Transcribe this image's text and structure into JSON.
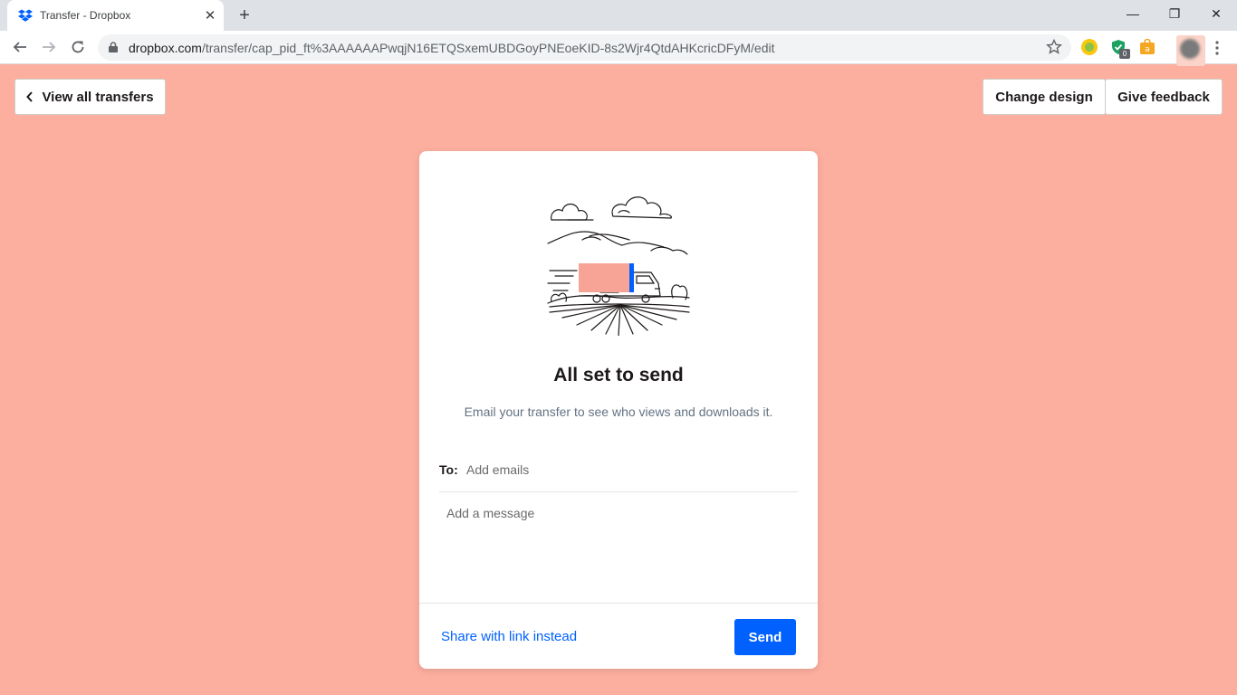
{
  "browser": {
    "tab_title": "Transfer - Dropbox",
    "tab_close": "✕",
    "new_tab": "+",
    "url_host": "dropbox.com",
    "url_path": "/transfer/cap_pid_ft%3AAAAAAPwqjN16ETQSxemUBDGoyPNEoeKID-8s2Wjr4QtdAHKcricDFyM/edit",
    "extension_badge": "0",
    "window_controls": {
      "minimize": "—",
      "maximize": "❐",
      "close": "✕"
    }
  },
  "header": {
    "back_label": "View all transfers",
    "change_design_label": "Change design",
    "give_feedback_label": "Give feedback"
  },
  "card": {
    "heading": "All set to send",
    "subtext": "Email your transfer to see who views and downloads it.",
    "to_label": "To:",
    "to_placeholder": "Add emails",
    "message_placeholder": "Add a message",
    "share_link_label": "Share with link instead",
    "send_label": "Send"
  },
  "colors": {
    "page_background": "#fdaf9f",
    "primary_blue": "#0061fe",
    "truck_cargo": "#f7a497"
  },
  "icons": {
    "favicon": "dropbox-icon",
    "lock": "lock-icon",
    "star": "bookmark-star-icon",
    "illustration": "delivery-truck-landscape"
  }
}
